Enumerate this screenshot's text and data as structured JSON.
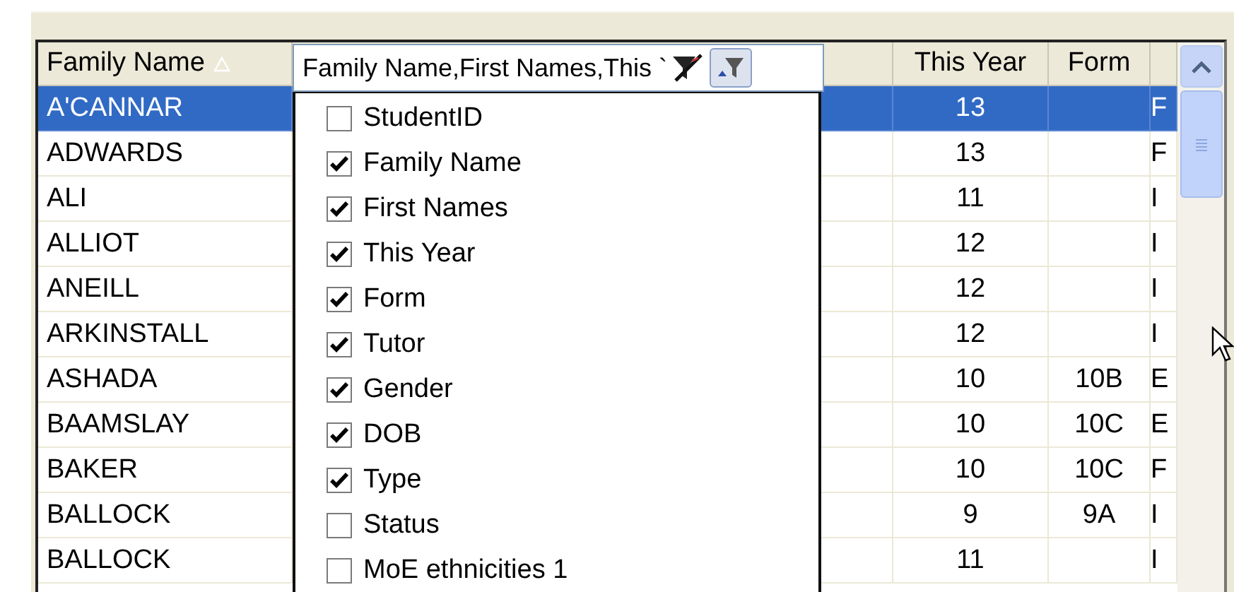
{
  "table": {
    "columns": [
      {
        "label": "Family Name",
        "sorted": true
      },
      {
        "label": "This Year"
      },
      {
        "label": "Form"
      }
    ],
    "rows": [
      {
        "family_name": "A'CANNAR",
        "this_year": "13",
        "form": "",
        "column_5": "F",
        "selected": true
      },
      {
        "family_name": "ADWARDS",
        "this_year": "13",
        "form": "",
        "column_5": "F",
        "selected": false
      },
      {
        "family_name": "ALI",
        "this_year": "11",
        "form": "",
        "column_5": "I",
        "selected": false
      },
      {
        "family_name": "ALLIOT",
        "this_year": "12",
        "form": "",
        "column_5": "I",
        "selected": false
      },
      {
        "family_name": "ANEILL",
        "this_year": "12",
        "form": "",
        "column_5": "I",
        "selected": false
      },
      {
        "family_name": "ARKINSTALL",
        "this_year": "12",
        "form": "",
        "column_5": "I",
        "selected": false
      },
      {
        "family_name": "ASHADA",
        "this_year": "10",
        "form": "10B",
        "column_5": "E",
        "selected": false
      },
      {
        "family_name": "BAAMSLAY",
        "this_year": "10",
        "form": "10C",
        "column_5": "E",
        "selected": false
      },
      {
        "family_name": "BAKER",
        "this_year": "10",
        "form": "10C",
        "column_5": "F",
        "selected": false
      },
      {
        "family_name": "BALLOCK",
        "this_year": "9",
        "form": "9A",
        "column_5": "I",
        "selected": false
      },
      {
        "family_name": "BALLOCK",
        "this_year": "11",
        "form": "",
        "column_5": "I",
        "selected": false
      }
    ]
  },
  "column_chooser": {
    "value": "Family Name,First Names,This `",
    "items": [
      {
        "label": "StudentID",
        "checked": false
      },
      {
        "label": "Family Name",
        "checked": true
      },
      {
        "label": "First Names",
        "checked": true
      },
      {
        "label": "This Year",
        "checked": true
      },
      {
        "label": "Form",
        "checked": true
      },
      {
        "label": "Tutor",
        "checked": true
      },
      {
        "label": "Gender",
        "checked": true
      },
      {
        "label": "DOB",
        "checked": true
      },
      {
        "label": "Type",
        "checked": true
      },
      {
        "label": "Status",
        "checked": false
      },
      {
        "label": "MoE ethnicities 1",
        "checked": false
      }
    ]
  }
}
